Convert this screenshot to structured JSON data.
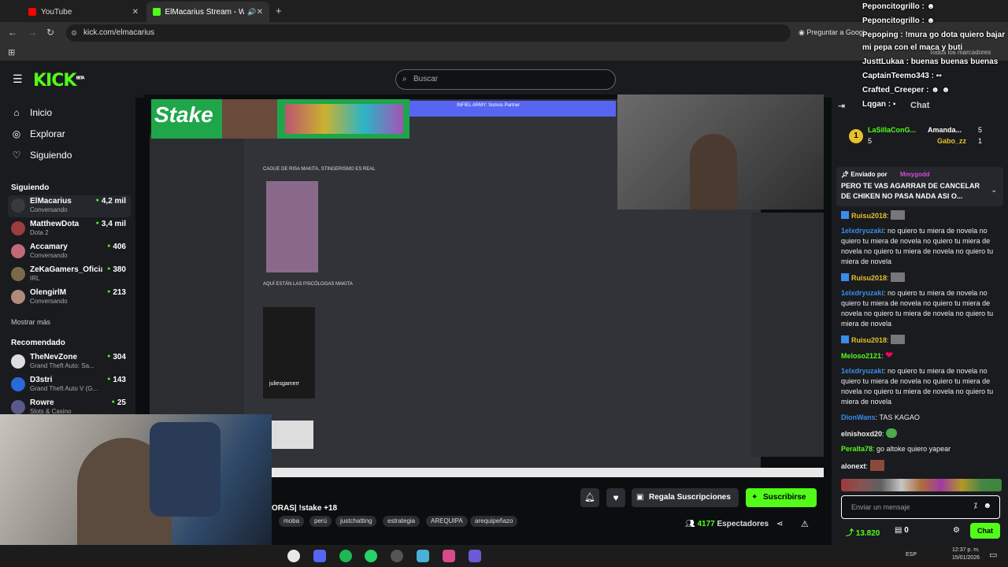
{
  "browser": {
    "tabs": [
      {
        "title": "YouTube"
      },
      {
        "title": "ElMacarius Stream - Watch"
      }
    ],
    "url": "kick.com/elmacarius",
    "translate_label": "Preguntar a Googl",
    "bookmarks_label": "Todos los marcadores"
  },
  "header": {
    "logo": "KICK",
    "logo_sup": "BETA",
    "search_placeholder": "Buscar"
  },
  "sidebar": {
    "nav": [
      {
        "label": "Inicio",
        "icon": "home-icon"
      },
      {
        "label": "Explorar",
        "icon": "compass-icon"
      },
      {
        "label": "Siguiendo",
        "icon": "heart-icon"
      }
    ],
    "following_title": "Siguiendo",
    "following": [
      {
        "name": "ElMacarius",
        "sub": "Conversando",
        "viewers": "4,2 mil"
      },
      {
        "name": "MatthewDota",
        "sub": "Dota 2",
        "viewers": "3,4 mil"
      },
      {
        "name": "Accamary",
        "sub": "Conversando",
        "viewers": "406"
      },
      {
        "name": "ZeKaGamers_Oficial",
        "sub": "IRL",
        "viewers": "380"
      },
      {
        "name": "OlengirlM",
        "sub": "Conversando",
        "viewers": "213"
      }
    ],
    "show_more": "Mostrar más",
    "recommended_title": "Recomendado",
    "recommended": [
      {
        "name": "TheNevZone",
        "sub": "Grand Theft Auto: Sa...",
        "viewers": "304"
      },
      {
        "name": "D3stri",
        "sub": "Grand Theft Auto V (G...",
        "viewers": "143"
      },
      {
        "name": "Rowre",
        "sub": "Slots & Casino",
        "viewers": "25"
      }
    ]
  },
  "stream": {
    "title_fragment": "ORAS| !stake +18",
    "tags": [
      "moba",
      "perú",
      "justchatting",
      "estrategia",
      "AREQUIPA",
      "arequipeñazo"
    ],
    "gift_button": "Regala Suscripciones",
    "subscribe_button": "Suscribirse",
    "viewers": "4177",
    "viewers_label": "Espectadores",
    "video_texts": {
      "sponsor": "Stake",
      "caption1": "CAGUE DE RISA MAKITA, STINGERISMO ES REAL",
      "caption2": "AQUÍ ESTÁN LAS PSICÓLOGAS MAKITA",
      "watermark": "juliesgamerr",
      "banner": "INFIEL ARMY: Somos Partner"
    }
  },
  "chat": {
    "title": "Chat",
    "top_gifters": [
      {
        "name": "LaSillaConG...",
        "count": "5"
      },
      {
        "name": "Amanda...",
        "count": "5"
      },
      {
        "name": "Gabo_zz",
        "count": "1"
      }
    ],
    "pinned_label": "Enviado por",
    "pinned_user": "Mmygodd",
    "pinned_text": "PERO TE VAS AGARRAR DE CANCELAR DE CHIKEN NO PASA NADA ASI O...",
    "messages": [
      {
        "user": "Ruisu2018",
        "text": "",
        "color": "#e8c02a"
      },
      {
        "user": "1elxdryuzaki",
        "text": "no quiero tu miera de novela no quiero tu miera de novela no quiero tu miera de novela no quiero tu miera de novela no quiero tu miera de novela",
        "color": "#3a8ce8"
      },
      {
        "user": "Ruisu2018",
        "text": "",
        "color": "#e8c02a"
      },
      {
        "user": "1elxdryuzaki",
        "text": "no quiero tu miera de novela no quiero tu miera de novela no quiero tu miera de novela no quiero tu miera de novela no quiero tu miera de novela",
        "color": "#3a8ce8"
      },
      {
        "user": "Ruisu2018",
        "text": "",
        "color": "#e8c02a"
      },
      {
        "user": "Meloso2121",
        "text": "",
        "color": "#53fc18"
      },
      {
        "user": "1elxdryuzaki",
        "text": "no quiero tu miera de novela no quiero tu miera de novela no quiero tu miera de novela no quiero tu miera de novela no quiero tu miera de novela",
        "color": "#3a8ce8"
      },
      {
        "user": "DionWans",
        "text": "TAS KAGAO",
        "color": "#3a8ce8"
      },
      {
        "user": "elnishoxd20",
        "text": "",
        "color": "#fff"
      },
      {
        "user": "Peralta78",
        "text": "go altoke quiero yapear",
        "color": "#53fc18"
      },
      {
        "user": "alonext",
        "text": "",
        "color": "#fff"
      }
    ],
    "input_placeholder": "Enviar un mensaje",
    "points": "13.820",
    "gifts_count": "0",
    "send_button": "Chat"
  },
  "overlay_chat": [
    {
      "user": "Peponcitogrillo",
      "text": ""
    },
    {
      "user": "Peponcitogrillo",
      "text": ""
    },
    {
      "user": "Pepoping",
      "text": "!mura go dota quiero bajar"
    },
    {
      "user": "",
      "text": "mi pepa con el maca y buti"
    },
    {
      "user": "JusttLukaa",
      "text": "buenas buenas buenas"
    },
    {
      "user": "CaptainTeemo343",
      "text": ""
    },
    {
      "user": "Crafted_Creeper",
      "text": ""
    },
    {
      "user": "Lqgan",
      "text": ""
    }
  ],
  "taskbar": {
    "time": "12:37 p. m.",
    "date": "15/01/2026",
    "lang": "ESP"
  },
  "colors": {
    "accent": "#53fc18",
    "chat_bg": "#191b1f",
    "page_bg": "#0b0e0f"
  }
}
